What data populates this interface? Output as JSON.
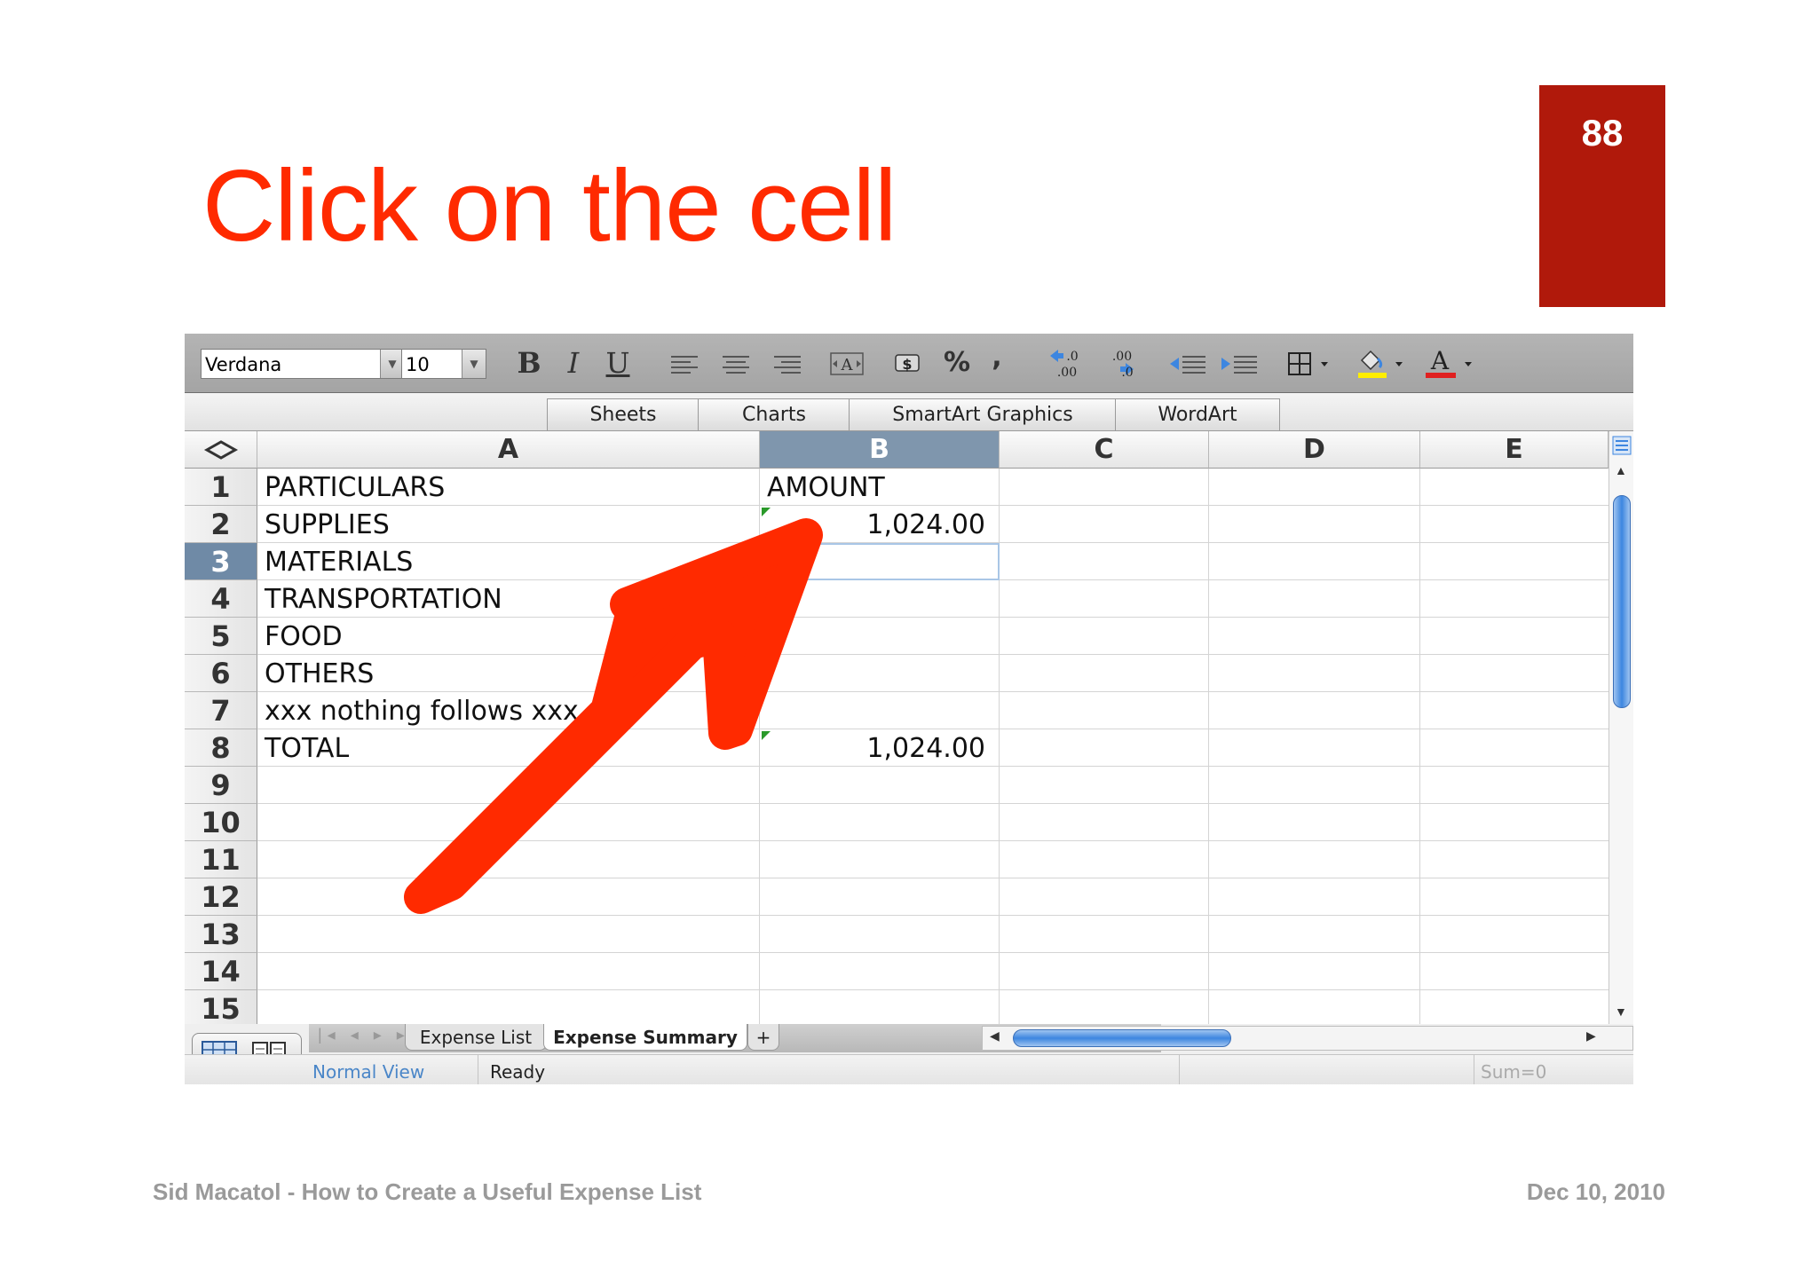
{
  "slide": {
    "title": "Click on the cell",
    "page_number": "88",
    "footer_left": "Sid Macatol - How to Create a Useful Expense List",
    "footer_right": "Dec 10, 2010",
    "accent_color": "#ff2a00",
    "badge_color": "#b0190b"
  },
  "toolbar": {
    "font_name": "Verdana",
    "font_size": "10",
    "bold_label": "B",
    "italic_label": "I",
    "underline_label": "U",
    "percent_label": "%",
    "comma_label": ",",
    "icons": [
      "align-left-icon",
      "align-center-icon",
      "align-right-icon",
      "merge-icon",
      "currency-icon",
      "increase-decimal-icon",
      "decrease-decimal-icon",
      "decrease-indent-icon",
      "increase-indent-icon",
      "borders-icon",
      "fill-color-icon",
      "font-color-icon"
    ]
  },
  "ribbon": {
    "tabs": [
      "Sheets",
      "Charts",
      "SmartArt Graphics",
      "WordArt"
    ]
  },
  "sheet": {
    "columns": [
      "A",
      "B",
      "C",
      "D",
      "E"
    ],
    "selected_column": "B",
    "rows": [
      "1",
      "2",
      "3",
      "4",
      "5",
      "6",
      "7",
      "8",
      "9",
      "10",
      "11",
      "12",
      "13",
      "14",
      "15"
    ],
    "selected_row": "3",
    "cells": {
      "A1": "PARTICULARS",
      "B1": "AMOUNT",
      "A2": "SUPPLIES",
      "B2": "1,024.00",
      "A3": "MATERIALS",
      "A4": "TRANSPORTATION",
      "A5": "FOOD",
      "A6": "OTHERS",
      "A7": "xxx nothing follows xxx",
      "A8": "TOTAL",
      "B8": "1,024.00"
    }
  },
  "sheet_tabs": [
    "Expense List",
    "Expense Summary",
    "+"
  ],
  "status": {
    "view": "Normal View",
    "state": "Ready",
    "sum": "Sum=0"
  }
}
